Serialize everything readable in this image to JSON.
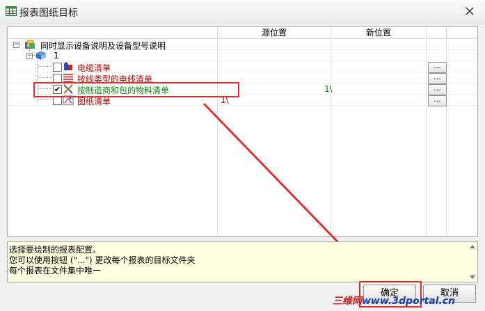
{
  "window": {
    "title": "报表图纸目标"
  },
  "table": {
    "col_source": "源位置",
    "col_new": "新位置",
    "root_label": "同时显示设备说明及设备型号说明",
    "group_label": "1",
    "rows": [
      {
        "label": "电缆清单",
        "source": "",
        "new": "",
        "checked": false,
        "browse": "...",
        "color": "#b00000"
      },
      {
        "label": "按线类型的电线清单",
        "source": "",
        "new": "",
        "checked": false,
        "browse": "...",
        "color": "#b00000"
      },
      {
        "label": "按制造商和包的物料清单",
        "source": "",
        "new": "1\\",
        "checked": true,
        "browse": "...",
        "color": "#0a8a0a"
      },
      {
        "label": "图纸清单",
        "source": "1\\",
        "new": "",
        "checked": false,
        "browse": "...",
        "color": "#b00000"
      }
    ]
  },
  "info": {
    "line1": "选择要绘制的报表配置。",
    "line2": "您可以使用按钮 (\"...\") 更改每个报表的目标文件夹",
    "line3": "每个报表在文件集中唯一"
  },
  "buttons": {
    "ok": "确定",
    "cancel": "取消"
  },
  "watermark": {
    "part1": "三维网",
    "part2": "www.3dportal.cn"
  },
  "colors": {
    "highlight": "#e03030",
    "arrow": "#e03030",
    "info_bg": "#ffffe1"
  }
}
